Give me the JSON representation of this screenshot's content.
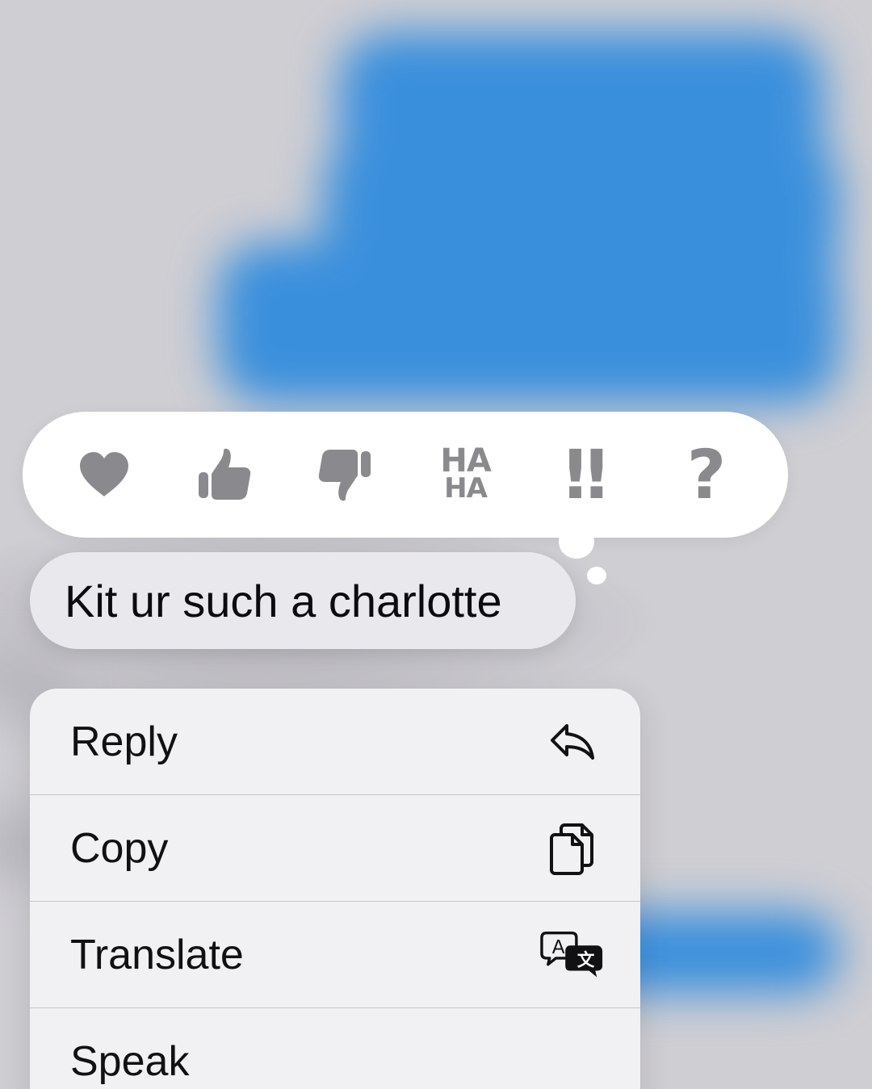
{
  "tapbacks": [
    {
      "name": "heart",
      "label": ""
    },
    {
      "name": "thumbs-up",
      "label": ""
    },
    {
      "name": "thumbs-down",
      "label": ""
    },
    {
      "name": "haha",
      "label_top": "HA",
      "label_bottom": "HA"
    },
    {
      "name": "emphasize",
      "label": "‼"
    },
    {
      "name": "question",
      "label": "?"
    }
  ],
  "message": {
    "text": "Kit ur such a charlotte"
  },
  "menu": {
    "items": [
      {
        "label": "Reply",
        "icon": "reply-arrow-icon"
      },
      {
        "label": "Copy",
        "icon": "copy-icon"
      },
      {
        "label": "Translate",
        "icon": "translate-icon"
      },
      {
        "label": "Speak",
        "icon": "speaker-icon"
      }
    ]
  },
  "colors": {
    "background": "#cfced3",
    "blurred_bubble_blue": "#3a8fdc",
    "tapback_icon_grey": "#8a8a8e",
    "received_bubble": "#e9e9ed",
    "menu_background": "#f1f1f4"
  }
}
